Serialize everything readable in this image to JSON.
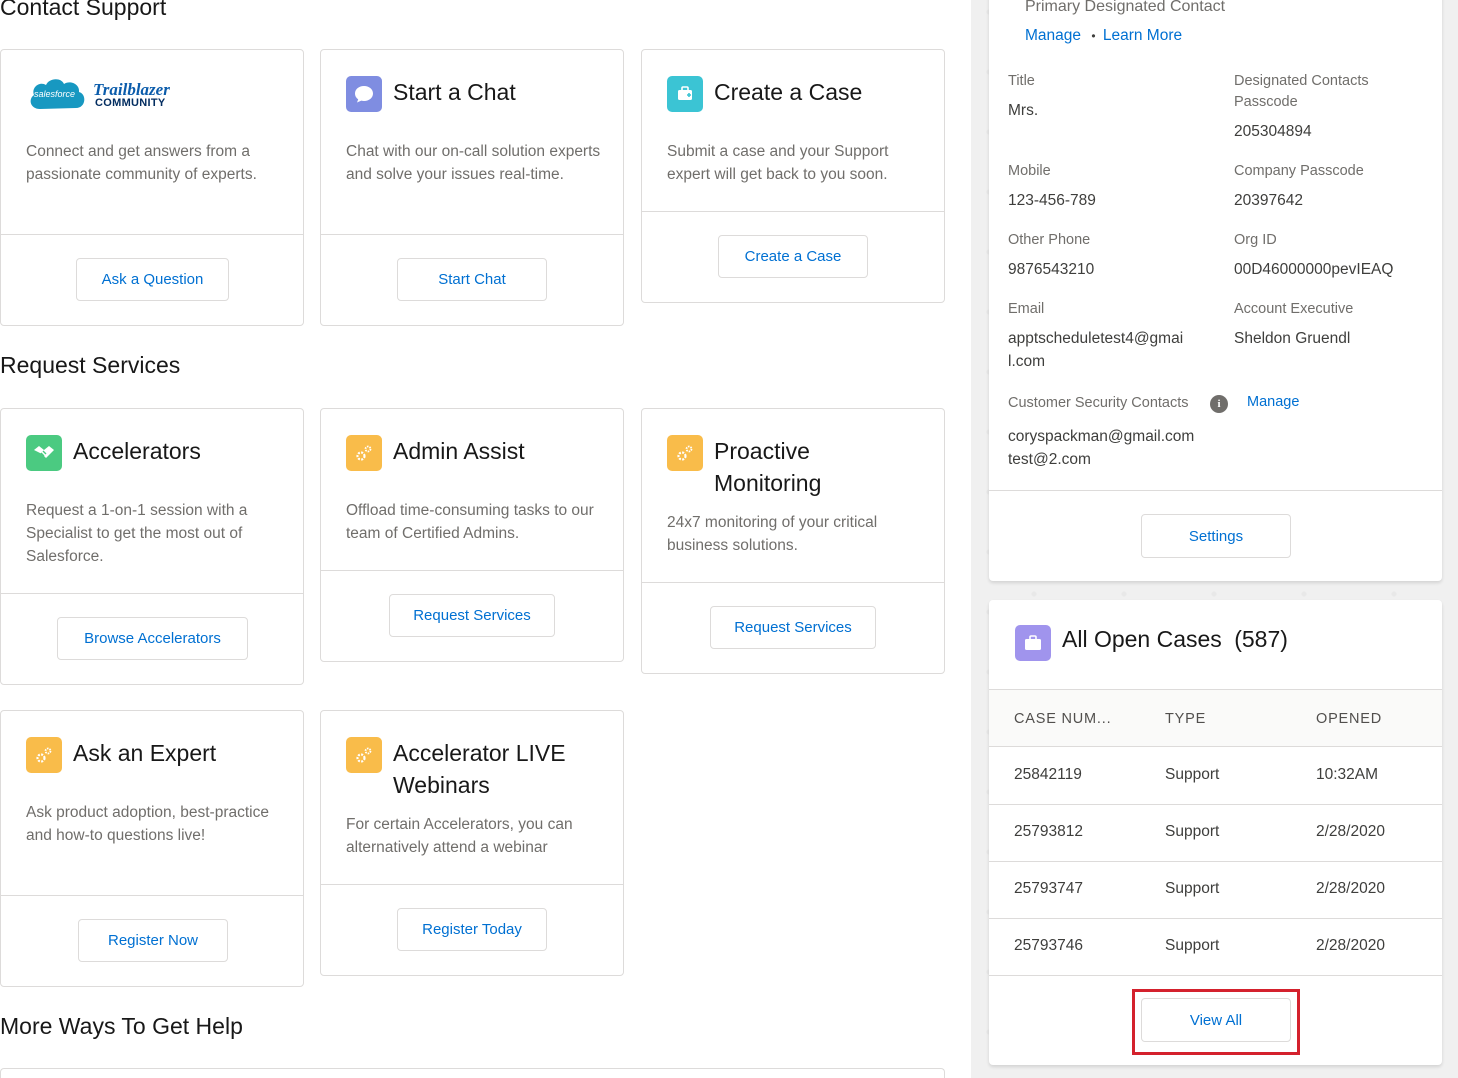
{
  "sections": {
    "contact_support": "Contact Support",
    "request_services": "Request Services",
    "more_ways": "More Ways To Get Help"
  },
  "cards": {
    "community": {
      "logo_left": "salesforce",
      "logo_right_top": "Trailblazer",
      "logo_right_bottom": "COMMUNITY",
      "desc": "Connect and get answers from a passionate community of experts.",
      "button": "Ask a Question"
    },
    "chat": {
      "title": "Start a Chat",
      "desc": "Chat with our on-call solution experts and solve your issues real-time.",
      "button": "Start Chat",
      "icon": "chat-bubble-icon"
    },
    "case": {
      "title": "Create a Case",
      "desc": "Submit a case and your Support expert will get back to you soon.",
      "button": "Create a Case",
      "icon": "case-icon"
    },
    "accelerators": {
      "title": "Accelerators",
      "desc": "Request a 1-on-1 session with a Specialist to get the most out of Salesforce.",
      "button": "Browse Accelerators",
      "icon": "handshake-icon"
    },
    "admin_assist": {
      "title": "Admin Assist",
      "desc": "Offload time-consuming tasks to our team of Certified Admins.",
      "button": "Request Services",
      "icon": "gears-icon"
    },
    "proactive": {
      "title_line1": "Proactive",
      "title_line2": "Monitoring",
      "desc": "24x7 monitoring of your critical business solutions.",
      "button": "Request Services",
      "icon": "gears-icon"
    },
    "expert": {
      "title": "Ask an Expert",
      "desc": "Ask product adoption, best-practice and how-to questions live!",
      "button": "Register Now",
      "icon": "gears-icon"
    },
    "webinars": {
      "title_line1": "Accelerator LIVE",
      "title_line2": "Webinars",
      "desc": "For certain Accelerators, you can alternatively attend a webinar",
      "button": "Register Today",
      "icon": "gears-icon"
    }
  },
  "contact_panel": {
    "heading": "Primary Designated Contact",
    "manage": "Manage",
    "separator": "•",
    "learn_more": "Learn More",
    "fields": {
      "title_label": "Title",
      "title_value": "Mrs.",
      "dc_passcode_label_1": "Designated Contacts",
      "dc_passcode_label_2": "Passcode",
      "dc_passcode_value": "205304894",
      "mobile_label": "Mobile",
      "mobile_value": "123-456-789",
      "company_passcode_label": "Company Passcode",
      "company_passcode_value": "20397642",
      "other_phone_label": "Other Phone",
      "other_phone_value": "9876543210",
      "org_id_label": "Org ID",
      "org_id_value": "00D46000000pevIEAQ",
      "email_label": "Email",
      "email_value_1": "apptscheduletest4@gmai",
      "email_value_2": "l.com",
      "ae_label": "Account Executive",
      "ae_value": "Sheldon Gruendl",
      "security_label": "Customer Security Contacts",
      "security_manage": "Manage",
      "security_1": "coryspackman@gmail.com",
      "security_2": "test@2.com"
    },
    "settings_button": "Settings"
  },
  "cases_panel": {
    "title": "All Open Cases",
    "count": "(587)",
    "columns": [
      "CASE NUM...",
      "TYPE",
      "OPENED"
    ],
    "rows": [
      {
        "number": "25842119",
        "type": "Support",
        "opened": "10:32AM"
      },
      {
        "number": "25793812",
        "type": "Support",
        "opened": "2/28/2020"
      },
      {
        "number": "25793747",
        "type": "Support",
        "opened": "2/28/2020"
      },
      {
        "number": "25793746",
        "type": "Support",
        "opened": "2/28/2020"
      }
    ],
    "view_all": "View All"
  },
  "colors": {
    "link": "#0070d2",
    "highlight": "#d4212d",
    "purple": "#7f8de1",
    "teal": "#3bc4d4",
    "green": "#4bca81",
    "orange": "#f9bc4a",
    "cases_icon": "#a094ed"
  }
}
